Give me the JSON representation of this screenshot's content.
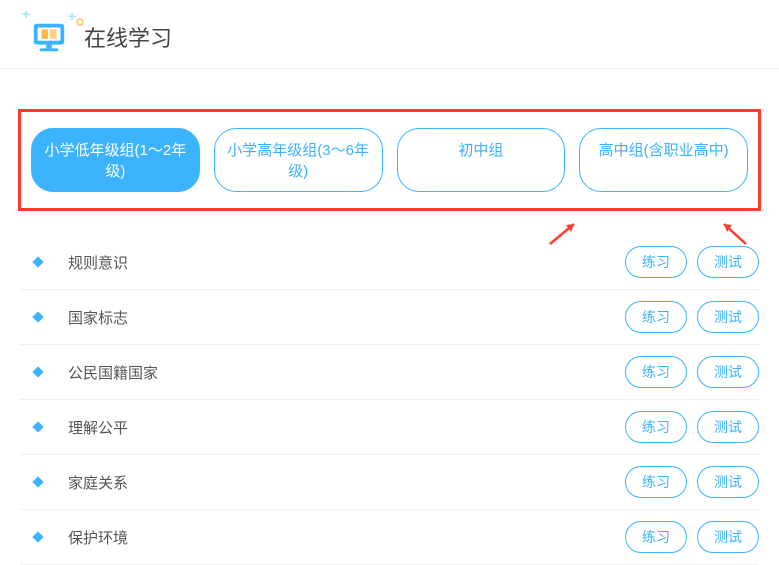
{
  "header": {
    "title": "在线学习"
  },
  "tabs": [
    {
      "label": "小学低年级组(1～2年级)",
      "active": true
    },
    {
      "label": "小学高年级组(3～6年级)",
      "active": false
    },
    {
      "label": "初中组",
      "active": false
    },
    {
      "label": "高中组(含职业高中)",
      "active": false
    }
  ],
  "buttons": {
    "practice": "练习",
    "test": "测试"
  },
  "topics": [
    {
      "label": "规则意识"
    },
    {
      "label": "国家标志"
    },
    {
      "label": "公民国籍国家"
    },
    {
      "label": "理解公平"
    },
    {
      "label": "家庭关系"
    },
    {
      "label": "保护环境"
    }
  ]
}
